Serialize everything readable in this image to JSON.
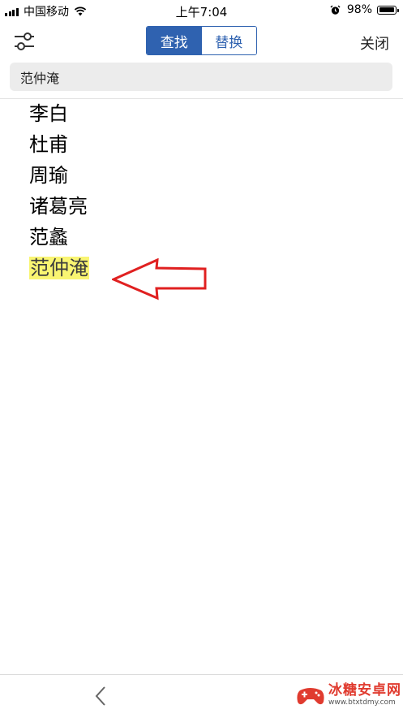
{
  "status_bar": {
    "carrier": "中国移动",
    "time": "上午7:04",
    "battery_percent": "98%",
    "battery_level": 0.98,
    "icons": [
      "signal-icon",
      "wifi-icon",
      "alarm-icon",
      "battery-icon"
    ]
  },
  "toolbar": {
    "options_icon": "sliders-icon",
    "tabs": [
      {
        "label": "查找",
        "active": true
      },
      {
        "label": "替换",
        "active": false
      }
    ],
    "close_label": "关闭"
  },
  "search": {
    "value": "范仲淹"
  },
  "document": {
    "lines": [
      "李白",
      "杜甫",
      "周瑜",
      "诸葛亮",
      "范蠡",
      "范仲淹"
    ],
    "highlighted_index": 5
  },
  "annotation": {
    "arrow_color": "#e02020"
  },
  "bottom_bar": {
    "back_icon": "chevron-left-icon",
    "watermark": {
      "title": "冰糖安卓网",
      "url": "www.btxtdmy.com"
    }
  },
  "colors": {
    "accent": "#2f62b0",
    "highlight": "#f9f572"
  }
}
